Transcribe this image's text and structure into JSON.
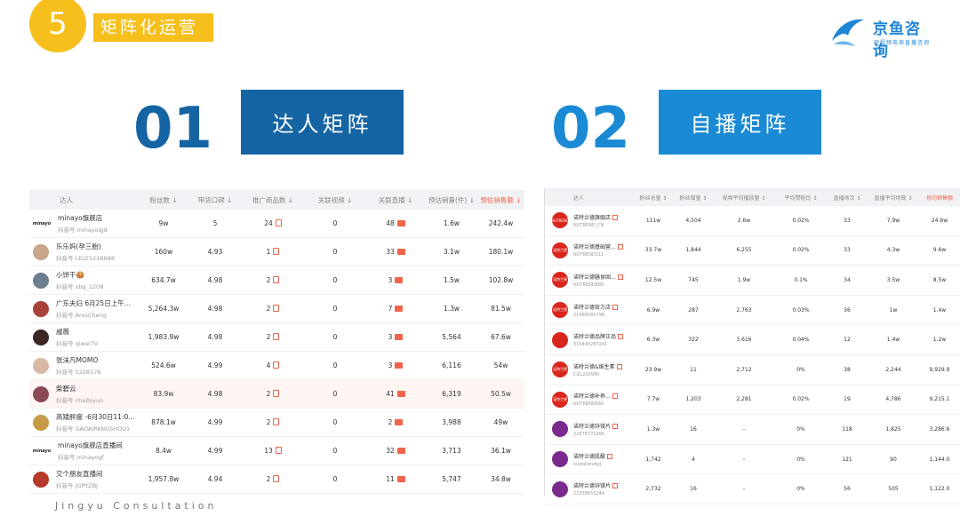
{
  "header": {
    "number": "5",
    "title": "矩阵化运营"
  },
  "logo": {
    "name": "京鱼咨询",
    "sub": "短视频电商直播咨询"
  },
  "sections": [
    {
      "num": "01",
      "label": "达人矩阵"
    },
    {
      "num": "02",
      "label": "自播矩阵"
    }
  ],
  "left_table": {
    "headers": [
      "达人",
      "粉丝数 ↓",
      "带货口碑 ↓",
      "推广商品数 ↓",
      "关联视频 ↓",
      "关联直播 ↓",
      "预估销量(件) ↓",
      "预估销售额 ↓"
    ],
    "rows": [
      {
        "name": "minayo旗舰店",
        "acct": "抖音号 minayoqjd",
        "fans": "9w",
        "rating": "5",
        "goods": "24",
        "videos": "0",
        "lives": "48",
        "sales": "1.6w",
        "revenue": "242.4w",
        "avatar": "minayo",
        "color": "#ffffff"
      },
      {
        "name": "乐乐妈(孕三胎)",
        "acct": "抖音号 LELE5216688",
        "fans": "160w",
        "rating": "4.93",
        "goods": "1",
        "videos": "0",
        "lives": "33",
        "sales": "3.1w",
        "revenue": "180.1w",
        "avatar": "",
        "color": "#c9a58a"
      },
      {
        "name": "小饼干🍪",
        "acct": "抖音号 xbg_1208",
        "fans": "634.7w",
        "rating": "4.98",
        "goods": "2",
        "videos": "0",
        "lives": "3",
        "sales": "1.5w",
        "revenue": "102.8w",
        "avatar": "",
        "color": "#6b7f8f"
      },
      {
        "name": "广东夫妇 6月25日上午...",
        "acct": "抖音号 AresCheng",
        "fans": "5,264.3w",
        "rating": "4.98",
        "goods": "2",
        "videos": "0",
        "lives": "7",
        "sales": "1.3w",
        "revenue": "81.5w",
        "avatar": "",
        "color": "#a8433a"
      },
      {
        "name": "戚薇",
        "acct": "抖音号 qiwei7V",
        "fans": "1,983.9w",
        "rating": "4.98",
        "goods": "2",
        "videos": "0",
        "lives": "3",
        "sales": "5,564",
        "revenue": "67.6w",
        "avatar": "",
        "color": "#3a2622"
      },
      {
        "name": "张沫凡MOMO",
        "acct": "抖音号 5228176",
        "fans": "524.6w",
        "rating": "4.99",
        "goods": "4",
        "videos": "0",
        "lives": "3",
        "sales": "6,116",
        "revenue": "54w",
        "avatar": "",
        "color": "#d9b8a8"
      },
      {
        "name": "柴碧云",
        "acct": "抖音号 chaibiyun",
        "fans": "83.9w",
        "rating": "4.98",
        "goods": "2",
        "videos": "0",
        "lives": "41",
        "sales": "6,319",
        "revenue": "50.5w",
        "avatar": "",
        "color": "#8a4b55"
      },
      {
        "name": "高矮胖瘦 -6月30日11:0...",
        "acct": "抖音号 GAOAIPANGSHOU1",
        "fans": "878.1w",
        "rating": "4.99",
        "goods": "2",
        "videos": "0",
        "lives": "2",
        "sales": "3,988",
        "revenue": "49w",
        "avatar": "",
        "color": "#c79a45"
      },
      {
        "name": "minayo旗舰店直播间",
        "acct": "抖音号 minayogf",
        "fans": "8.4w",
        "rating": "4.99",
        "goods": "13",
        "videos": "0",
        "lives": "32",
        "sales": "3,713",
        "revenue": "36.1w",
        "avatar": "minayo",
        "color": "#ffffff"
      },
      {
        "name": "交个朋友直播间",
        "acct": "抖音号 JGPYZBJ",
        "fans": "1,957.8w",
        "rating": "4.94",
        "goods": "2",
        "videos": "0",
        "lives": "11",
        "sales": "5,747",
        "revenue": "34.8w",
        "avatar": "",
        "color": "#b53a2a"
      }
    ]
  },
  "right_table": {
    "headers": [
      "达人",
      "粉丝总量 ↕",
      "粉丝增量 ↕",
      "视频平均播放量 ↕",
      "平均赞粉比 ↕",
      "直播场次 ↕",
      "直播平均场观 ↕",
      "场均销售额"
    ],
    "rows": [
      {
        "name": "诺特兰德旗舰店",
        "acct": "NUTREND_CN",
        "fans": "111w",
        "inc": "4,504",
        "play": "2.6w",
        "ratio": "0.02%",
        "lives": "33",
        "views": "7.9w",
        "avg": "24.6w",
        "color": "#d9261c",
        "badge": "NUTREND"
      },
      {
        "name": "诺特兰德基础营...",
        "acct": "NUTREND111",
        "fans": "33.7w",
        "inc": "1,844",
        "play": "6,255",
        "ratio": "0.02%",
        "lives": "33",
        "views": "4.3w",
        "avg": "9.6w",
        "color": "#d9261c",
        "badge": "诺特兰德"
      },
      {
        "name": "诺特兰德膳食固...",
        "acct": "NUTREND888",
        "fans": "12.5w",
        "inc": "745",
        "play": "1.9w",
        "ratio": "0.1%",
        "lives": "34",
        "views": "3.5w",
        "avg": "8.5w",
        "color": "#d9261c",
        "badge": "诺特兰德"
      },
      {
        "name": "诺特兰德官方店",
        "acct": "21486585798",
        "fans": "6.9w",
        "inc": "287",
        "play": "2,763",
        "ratio": "0.03%",
        "lives": "36",
        "views": "1w",
        "avg": "1.4w",
        "color": "#d9261c",
        "badge": "诺特兰德"
      },
      {
        "name": "诺特兰德品牌正品",
        "acct": "316448287241",
        "fans": "6.3w",
        "inc": "322",
        "play": "3,616",
        "ratio": "0.04%",
        "lives": "12",
        "views": "1.4w",
        "avg": "1.2w",
        "color": "#d9261c",
        "badge": ""
      },
      {
        "name": "诺特兰德&维生素",
        "acct": "CGL200990",
        "fans": "23.9w",
        "inc": "11",
        "play": "2,712",
        "ratio": "0%",
        "lives": "38",
        "views": "2,244",
        "avg": "9,929.9",
        "color": "#d9261c",
        "badge": "诺特兰德"
      },
      {
        "name": "诺特兰德补养...",
        "acct": "NUTREND666",
        "fans": "7.7w",
        "inc": "1,203",
        "play": "2,281",
        "ratio": "0.02%",
        "lives": "19",
        "views": "4,786",
        "avg": "9,215.1",
        "color": "#d9261c",
        "badge": "诺特兰德"
      },
      {
        "name": "诺特兰德锌镁片",
        "acct": "22576771995",
        "fans": "1.3w",
        "inc": "16",
        "play": "–",
        "ratio": "0%",
        "lives": "118",
        "views": "1,825",
        "avg": "3,286.6",
        "color": "#7a2a8c",
        "badge": ""
      },
      {
        "name": "诺特兰德肌酸",
        "acct": "nuotelandejj",
        "fans": "1,742",
        "inc": "4",
        "play": "–",
        "ratio": "0%",
        "lives": "121",
        "views": "90",
        "avg": "1,144.0",
        "color": "#7a2a8c",
        "badge": ""
      },
      {
        "name": "诺特兰德锌镁片",
        "acct": "22338655244",
        "fans": "2,732",
        "inc": "16",
        "play": "–",
        "ratio": "0%",
        "lives": "56",
        "views": "505",
        "avg": "1,122.0",
        "color": "#7a2a8c",
        "badge": ""
      }
    ]
  },
  "footer": "Jingyu Consultation"
}
